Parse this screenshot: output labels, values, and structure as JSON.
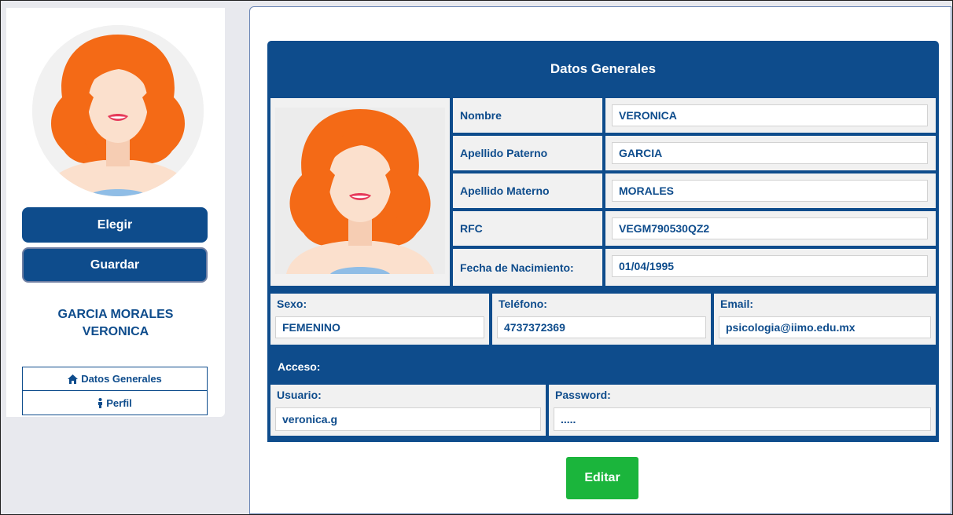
{
  "sidebar": {
    "avatar_icon": "woman-avatar",
    "buttons": {
      "choose": "Elegir",
      "save": "Guardar"
    },
    "name_line1": "GARCIA MORALES",
    "name_line2": "VERONICA",
    "nav": [
      {
        "label": "Datos Generales",
        "icon": "home-icon"
      },
      {
        "label": "Perfil",
        "icon": "person-icon"
      }
    ]
  },
  "card": {
    "title": "Datos Generales",
    "fields": {
      "nombre": {
        "label": "Nombre",
        "value": "VERONICA"
      },
      "apellido_paterno": {
        "label": "Apellido Paterno",
        "value": "GARCIA"
      },
      "apellido_materno": {
        "label": "Apellido Materno",
        "value": "MORALES"
      },
      "rfc": {
        "label": "RFC",
        "value": "VEGM790530QZ2"
      },
      "fecha_nacimiento": {
        "label": "Fecha de Nacimiento:",
        "value": "01/04/1995"
      },
      "sexo": {
        "label": "Sexo:",
        "value": "FEMENINO"
      },
      "telefono": {
        "label": "Teléfono:",
        "value": "4737372369"
      },
      "email": {
        "label": "Email:",
        "value": "psicologia@iimo.edu.mx"
      }
    },
    "access": {
      "label": "Acceso:",
      "usuario": {
        "label": "Usuario:",
        "value": "veronica.g"
      },
      "password": {
        "label": "Password:",
        "value": "....."
      }
    }
  },
  "actions": {
    "edit": "Editar"
  },
  "colors": {
    "primary": "#0e4c8c",
    "success": "#1bb53c",
    "hair": "#f46a16",
    "skin": "#fbe0cd"
  }
}
